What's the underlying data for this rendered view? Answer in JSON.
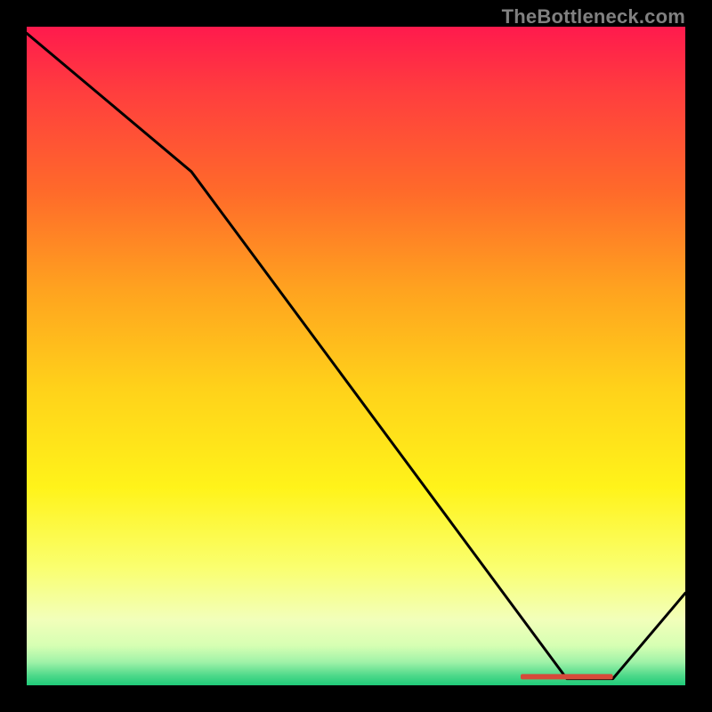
{
  "watermark": "TheBottleneck.com",
  "chart_data": {
    "type": "line",
    "title": "",
    "xlabel": "",
    "ylabel": "",
    "xlim": [
      0,
      100
    ],
    "ylim": [
      0,
      100
    ],
    "series": [
      {
        "name": "curve",
        "x": [
          0,
          25,
          82,
          89,
          100
        ],
        "values": [
          99,
          78,
          1,
          1,
          14
        ]
      }
    ],
    "marker": {
      "x_start": 75,
      "x_end": 89,
      "y": 1.3,
      "color": "#d64a3a"
    },
    "background_gradient": {
      "stops": [
        {
          "offset": 0.0,
          "color": "#ff1a4d"
        },
        {
          "offset": 0.1,
          "color": "#ff3e3e"
        },
        {
          "offset": 0.25,
          "color": "#ff6a2a"
        },
        {
          "offset": 0.4,
          "color": "#ffa31f"
        },
        {
          "offset": 0.55,
          "color": "#ffd21a"
        },
        {
          "offset": 0.7,
          "color": "#fff31a"
        },
        {
          "offset": 0.82,
          "color": "#faff6e"
        },
        {
          "offset": 0.9,
          "color": "#f2ffba"
        },
        {
          "offset": 0.94,
          "color": "#d6ffb3"
        },
        {
          "offset": 0.965,
          "color": "#9ff2a8"
        },
        {
          "offset": 0.985,
          "color": "#4fd98a"
        },
        {
          "offset": 1.0,
          "color": "#1fca79"
        }
      ]
    }
  }
}
